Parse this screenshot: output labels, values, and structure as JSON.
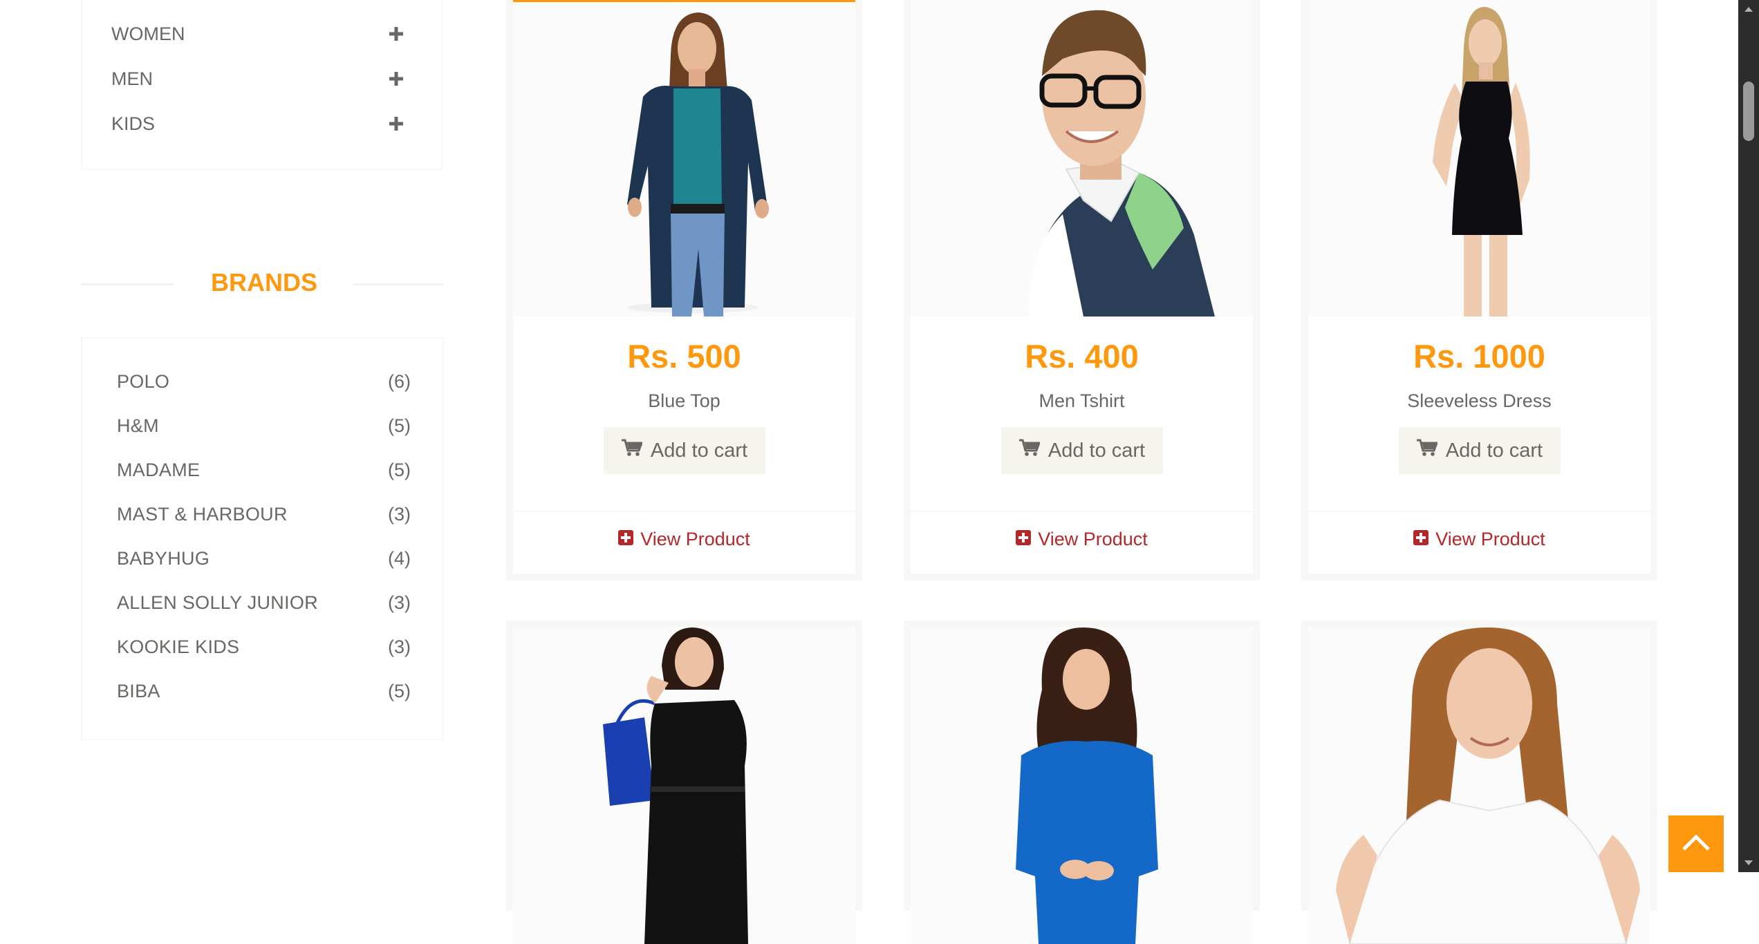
{
  "categories": [
    {
      "label": "WOMEN"
    },
    {
      "label": "MEN"
    },
    {
      "label": "KIDS"
    }
  ],
  "brands_title": "BRANDS",
  "brands": [
    {
      "name": "POLO",
      "count": "(6)"
    },
    {
      "name": "H&M",
      "count": "(5)"
    },
    {
      "name": "MADAME",
      "count": "(5)"
    },
    {
      "name": "MAST & HARBOUR",
      "count": "(3)"
    },
    {
      "name": "BABYHUG",
      "count": "(4)"
    },
    {
      "name": "ALLEN SOLLY JUNIOR",
      "count": "(3)"
    },
    {
      "name": "KOOKIE KIDS",
      "count": "(3)"
    },
    {
      "name": "BIBA",
      "count": "(5)"
    }
  ],
  "products": [
    {
      "price": "Rs. 500",
      "name": "Blue Top",
      "add_label": "Add to cart",
      "view_label": "View Product",
      "image": "woman-blue-top-photo"
    },
    {
      "price": "Rs. 400",
      "name": "Men Tshirt",
      "add_label": "Add to cart",
      "view_label": "View Product",
      "image": "man-glasses-tshirt-photo"
    },
    {
      "price": "Rs. 1000",
      "name": "Sleeveless Dress",
      "add_label": "Add to cart",
      "view_label": "View Product",
      "image": "woman-black-sleeveless-dress-photo"
    },
    {
      "image": "woman-black-dress-shopping-bag-photo"
    },
    {
      "image": "woman-blue-sweater-photo"
    },
    {
      "image": "girl-white-tshirt-photo"
    }
  ],
  "colors": {
    "accent": "#fe980f",
    "link": "#b4272b",
    "text": "#696763",
    "button_bg": "#f5f5ed"
  },
  "icons": {
    "category_toggle": "plus-icon",
    "cart": "shopping-cart-icon",
    "view": "plus-square-icon",
    "scroll_top": "chevron-up-icon"
  }
}
